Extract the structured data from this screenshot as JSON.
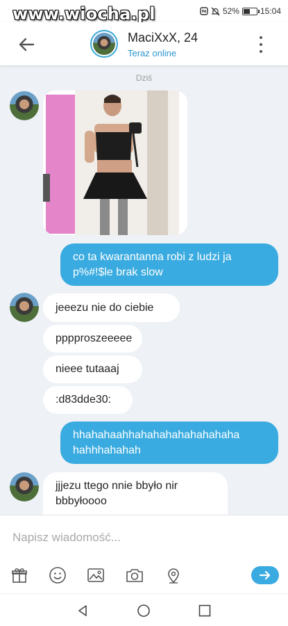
{
  "watermark": "www.wiocha.pl",
  "status_bar": {
    "battery": "52%",
    "time": "15:04",
    "battery_level": 0.52
  },
  "header": {
    "contact_name": "MaciXxX, 24",
    "status": "Teraz online"
  },
  "chat": {
    "day_label": "Dziś",
    "messages": [
      {
        "dir": "in",
        "type": "image"
      },
      {
        "dir": "out",
        "lines": [
          "co ta kwarantanna robi z ludzi ja",
          "p%#!$le brak slow"
        ]
      },
      {
        "dir": "in",
        "lines": [
          "jeeezu nie do ciebie"
        ]
      },
      {
        "dir": "in",
        "lines": [
          "pppproszeeeee"
        ]
      },
      {
        "dir": "in",
        "lines": [
          "nieee tutaaaj"
        ]
      },
      {
        "dir": "in",
        "lines": [
          ":d83dde30:"
        ]
      },
      {
        "dir": "out",
        "lines": [
          "hhahahaahhahahahahahahahaha",
          "hahhhahahah"
        ]
      },
      {
        "dir": "in",
        "lines": [
          "jjjezu ttego nnie bbyło nir",
          "bbbyłoooo"
        ]
      }
    ]
  },
  "composer": {
    "placeholder": "Napisz wiadomość..."
  },
  "colors": {
    "accent": "#3aabe0",
    "chat_bg": "#eef1f5",
    "link": "#2a95cf"
  },
  "icons": [
    "back-arrow-icon",
    "more-options-icon",
    "gift-icon",
    "emoji-icon",
    "image-icon",
    "camera-icon",
    "location-icon",
    "send-arrow-icon",
    "nav-back-icon",
    "nav-home-icon",
    "nav-recents-icon"
  ]
}
